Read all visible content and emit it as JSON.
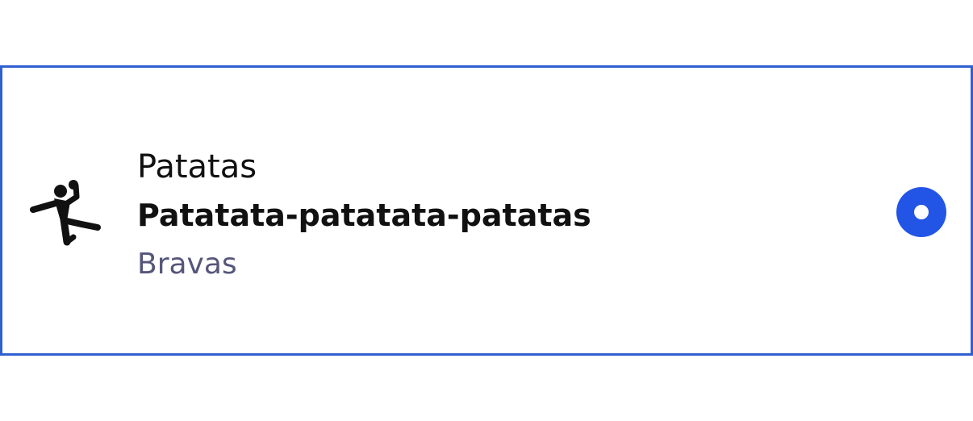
{
  "option": {
    "title": "Patatas",
    "subtitle": "Patatata-patatata-patatas",
    "caption": "Bravas",
    "icon": "handball-player-icon",
    "selected": true
  },
  "colors": {
    "border": "#2f5fd0",
    "radio": "#2255e6",
    "caption": "#55567a",
    "text": "#111111"
  }
}
